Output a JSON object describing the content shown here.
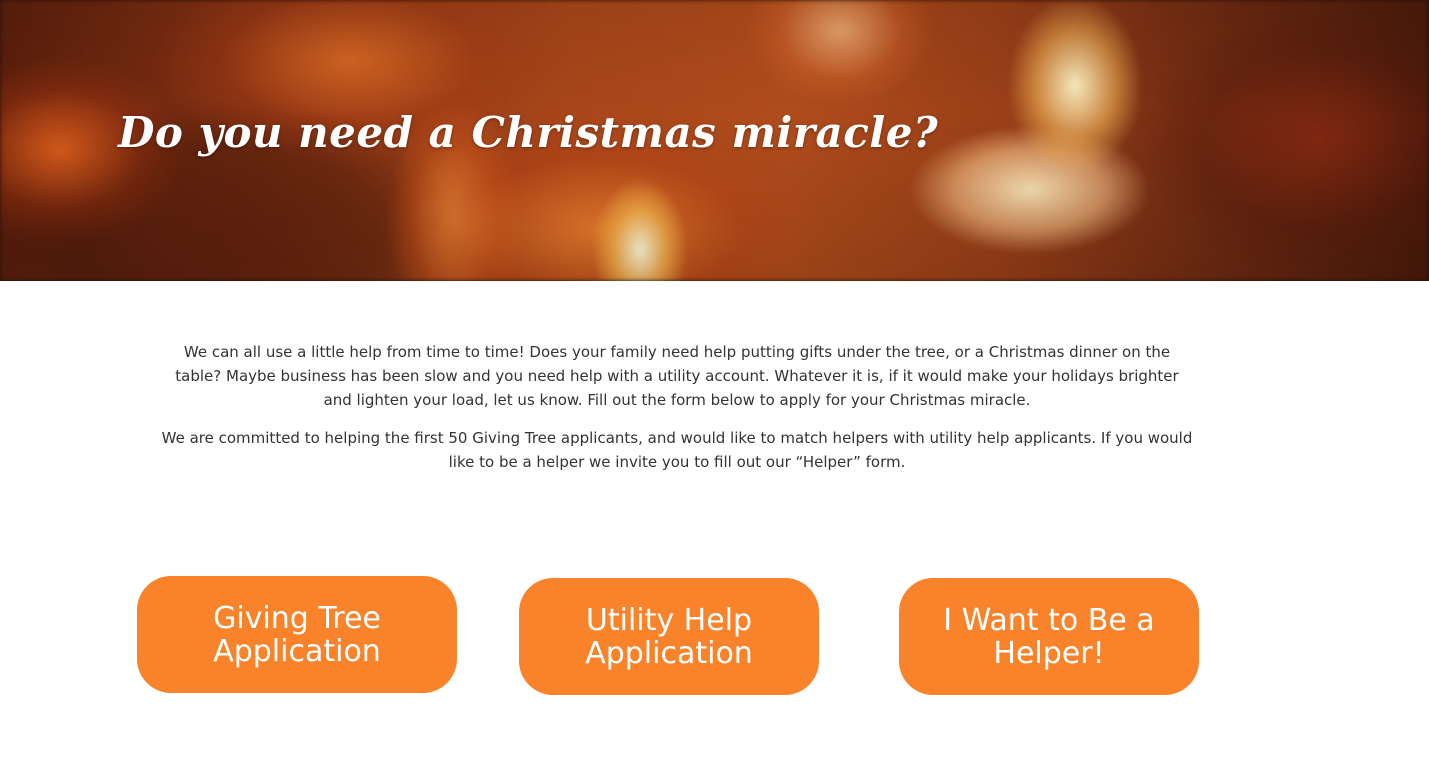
{
  "hero": {
    "title": "Do you need a Christmas miracle?"
  },
  "intro": {
    "paragraph_1": "We can all use a little help from time to time! Does your family need help putting gifts under the tree, or a Christmas dinner on the table? Maybe business has been slow and you need help with a utility account. Whatever it is, if it would make your holidays brighter and lighten your load, let us know. Fill out the form below to apply for your Christmas miracle.",
    "paragraph_2": "We are committed to helping the first 50 Giving Tree applicants, and would like to match helpers with utility help applicants. If you would like to be a helper we invite you to fill out our “Helper” form."
  },
  "buttons": {
    "giving_tree": "Giving Tree Application",
    "utility_help": "Utility Help Application",
    "helper": "I Want to Be a Helper!"
  },
  "colors": {
    "button_bg": "#f8832a",
    "button_text": "#ffffff",
    "body_text": "#333333"
  }
}
